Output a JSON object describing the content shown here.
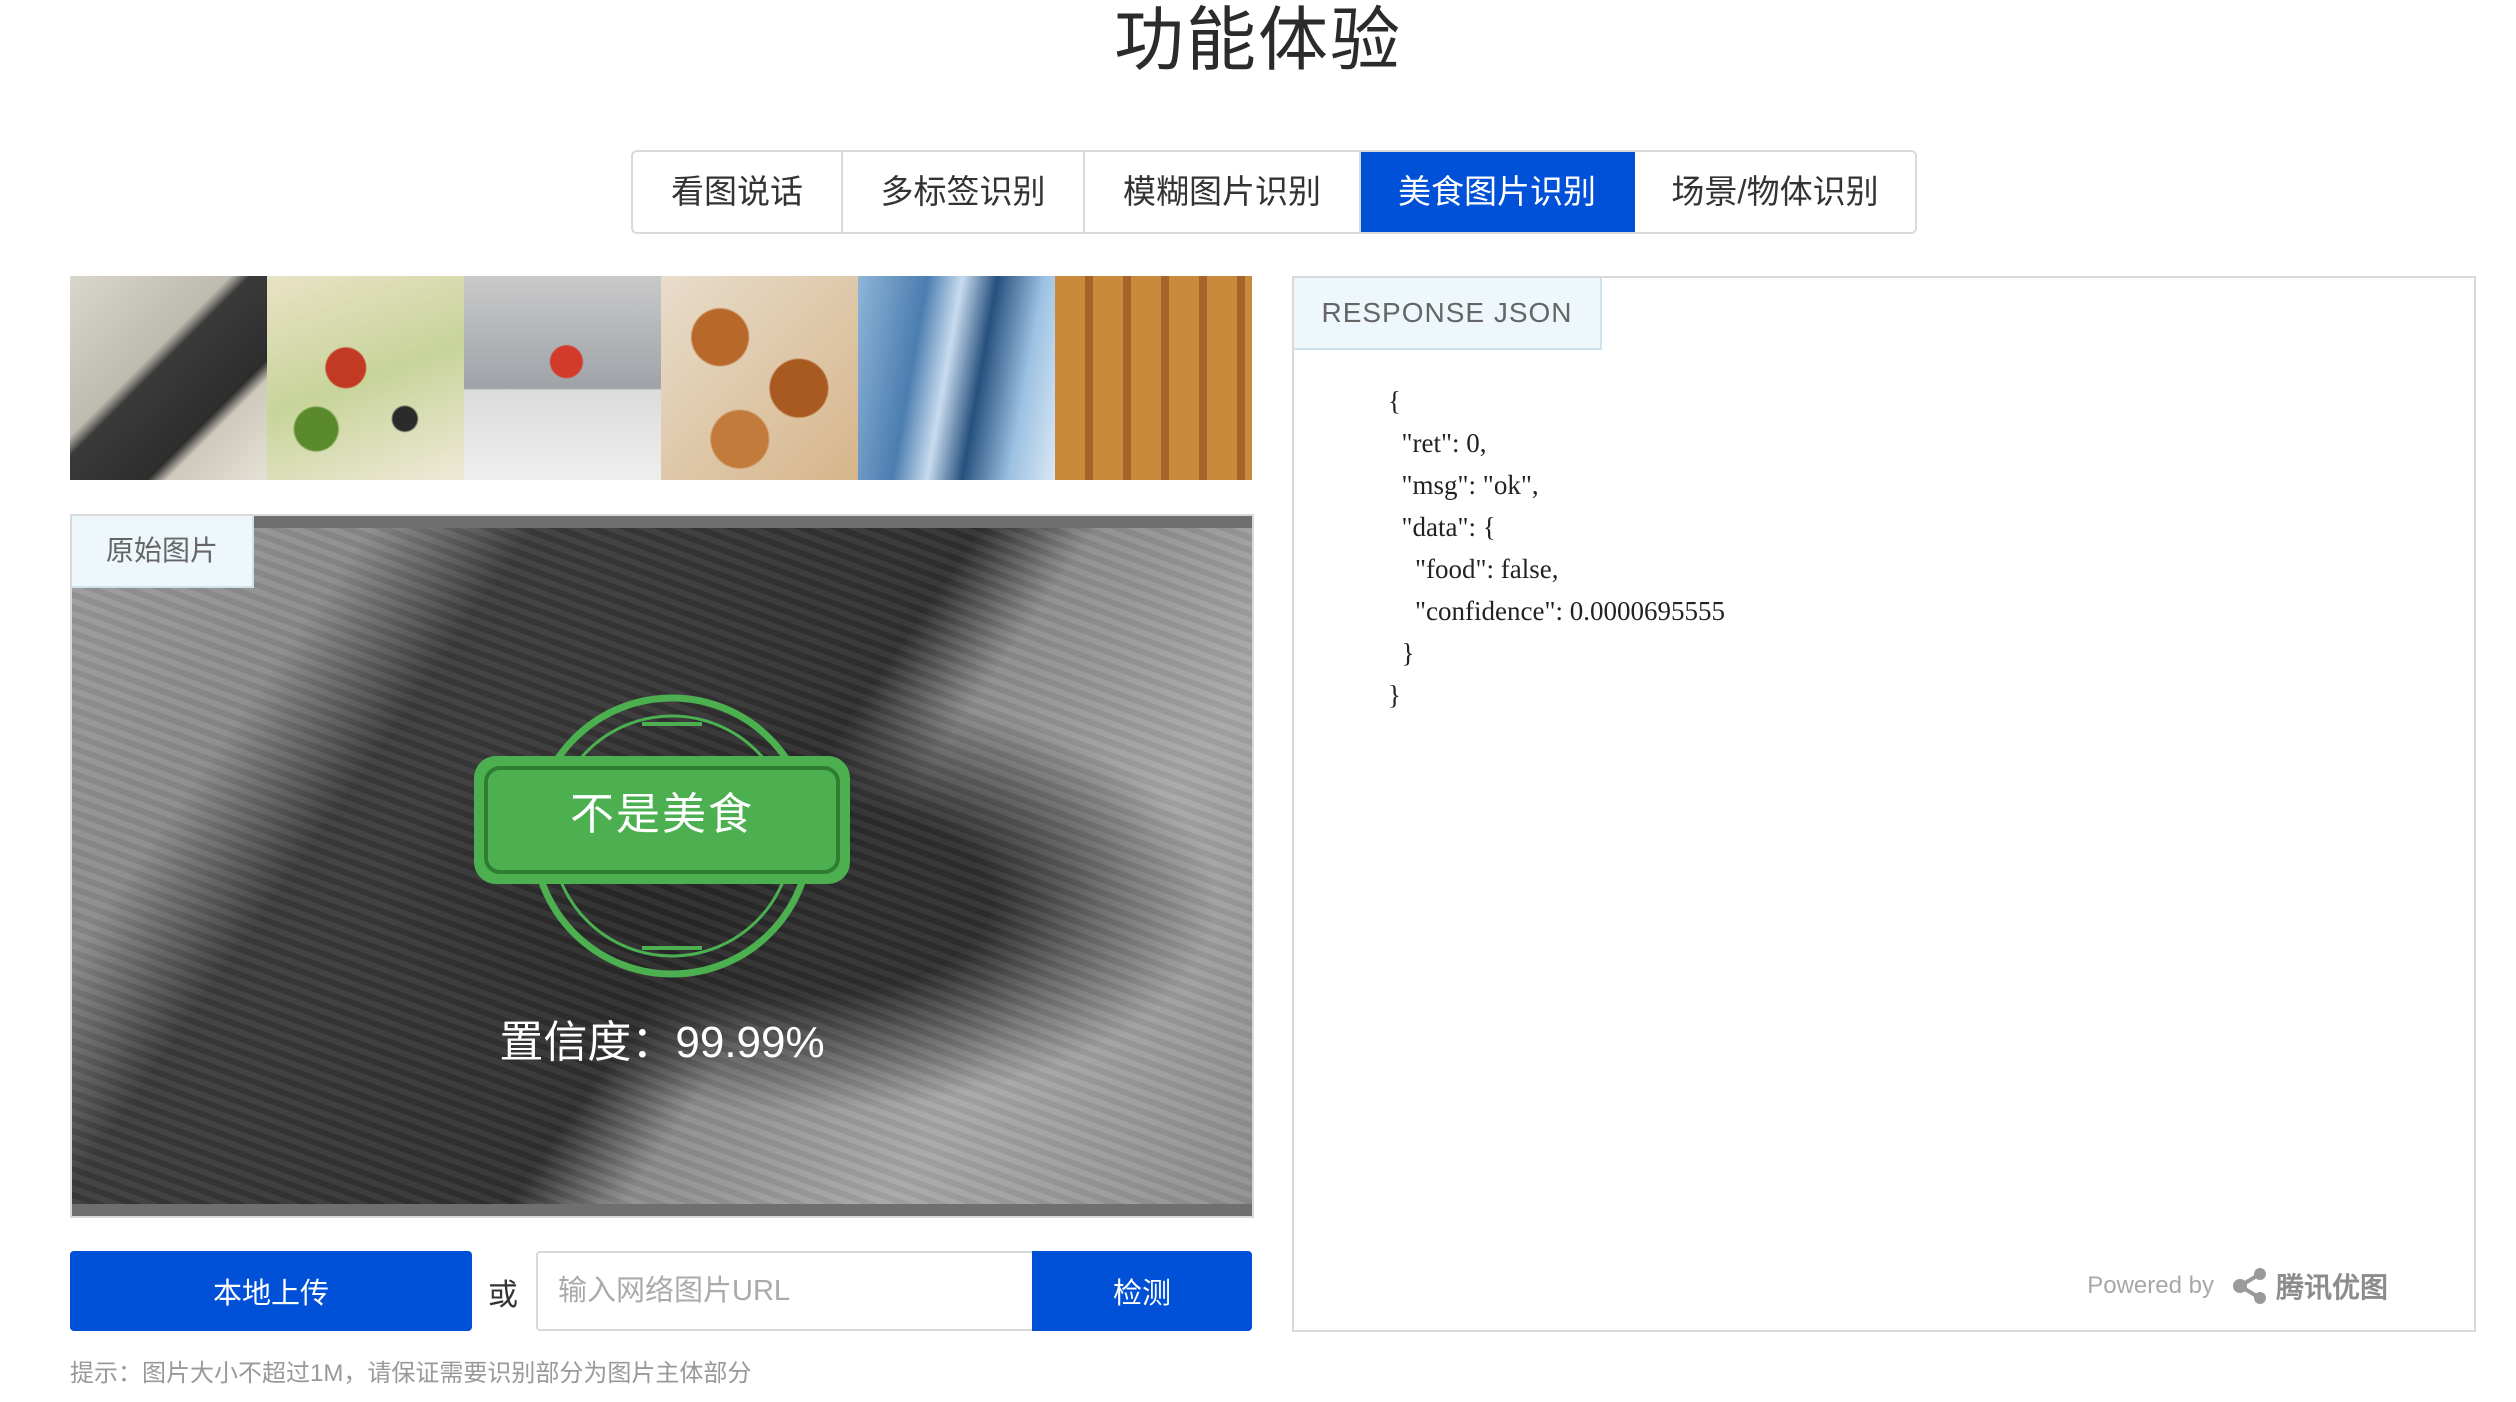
{
  "page": {
    "title": "功能体验"
  },
  "tabs": [
    {
      "label": "看图说话",
      "active": false
    },
    {
      "label": "多标签识别",
      "active": false
    },
    {
      "label": "模糊图片识别",
      "active": false
    },
    {
      "label": "美食图片识别",
      "active": true
    },
    {
      "label": "场景/物体识别",
      "active": false
    }
  ],
  "original": {
    "label": "原始图片",
    "verdict": "不是美食",
    "confidence_text": "置信度：99.99%"
  },
  "upload": {
    "local_button": "本地上传",
    "or_text": "或",
    "url_placeholder": "输入网络图片URL",
    "detect_button": "检测",
    "hint": "提示：图片大小不超过1M，请保证需要识别部分为图片主体部分"
  },
  "response": {
    "label": "RESPONSE JSON",
    "lines": [
      "{",
      "  \"ret\": 0,",
      "  \"msg\": \"ok\",",
      "  \"data\": {",
      "    \"food\": false,",
      "    \"confidence\": 0.0000695555",
      "  }",
      "}"
    ],
    "powered_by": "Powered by",
    "brand": "腾讯优图"
  },
  "colors": {
    "accent": "#0050d8",
    "stamp_green": "#4caf50"
  }
}
